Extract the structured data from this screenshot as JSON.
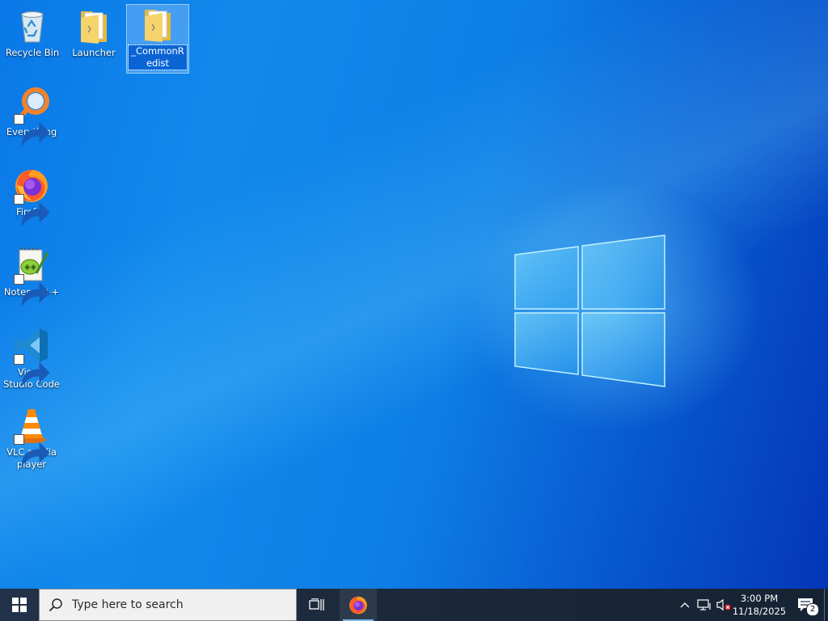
{
  "desktop": {
    "icons": [
      {
        "label": "Recycle Bin",
        "icon": "recycle-bin-icon",
        "shortcut": false,
        "selected": false
      },
      {
        "label": "Launcher",
        "icon": "folder-icon",
        "shortcut": false,
        "selected": false
      },
      {
        "label": "_CommonRedist",
        "icon": "folder-icon",
        "shortcut": false,
        "selected": true
      },
      {
        "label": "Everything",
        "icon": "everything-search-icon",
        "shortcut": true,
        "selected": false
      },
      {
        "label": "Firefox",
        "icon": "firefox-icon",
        "shortcut": true,
        "selected": false
      },
      {
        "label": "Notepad++",
        "icon": "notepad-plus-plus-icon",
        "shortcut": true,
        "selected": false
      },
      {
        "label": "Visual Studio Code",
        "icon": "vscode-icon",
        "shortcut": true,
        "selected": false
      },
      {
        "label": "VLC media player",
        "icon": "vlc-icon",
        "shortcut": true,
        "selected": false
      }
    ]
  },
  "taskbar": {
    "search_placeholder": "Type here to search",
    "pinned": [
      {
        "name": "Firefox",
        "icon": "firefox-icon",
        "running": true
      }
    ],
    "tray": {
      "clock_time": "3:00 PM",
      "clock_date": "11/18/2025",
      "notification_count": "2",
      "volume_state": "muted",
      "network_state": "wired-disconnected"
    }
  },
  "colors": {
    "wallpaper_blue": "#0a78e8",
    "taskbar_bg": "#1c2a3c",
    "selection_blue": "#0a64d4"
  }
}
